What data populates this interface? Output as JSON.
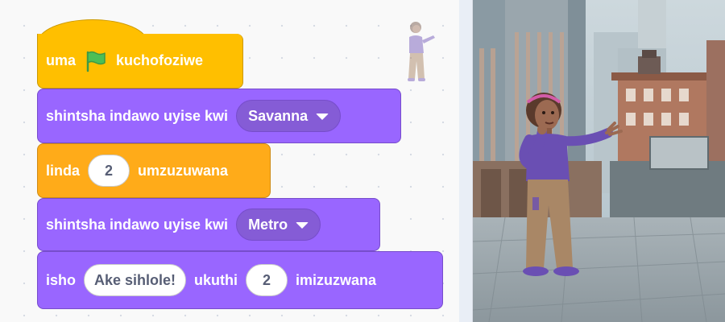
{
  "script": {
    "hat": {
      "before_flag": "uma",
      "after_flag": "kuchofoziwe"
    },
    "switch_backdrop_1": {
      "label": "shintsha indawo uyise kwi",
      "value": "Savanna"
    },
    "wait": {
      "label": "linda",
      "value": "2",
      "unit": "umzuzuwana"
    },
    "switch_backdrop_2": {
      "label": "shintsha indawo uyise kwi",
      "value": "Metro"
    },
    "say_for": {
      "label": "isho",
      "message": "Ake sihlole!",
      "connector": "ukuthi",
      "secs": "2",
      "unit": "imizuzwana"
    }
  },
  "colors": {
    "events": "#ffbf00",
    "looks": "#9966ff",
    "control": "#ffab19",
    "flag_green": "#4cbf56"
  },
  "icons": [
    "green-flag-icon",
    "dropdown-caret-icon",
    "sprite-thumbnail"
  ],
  "stage": {
    "backdrop": "city street",
    "sprite": "girl character"
  }
}
